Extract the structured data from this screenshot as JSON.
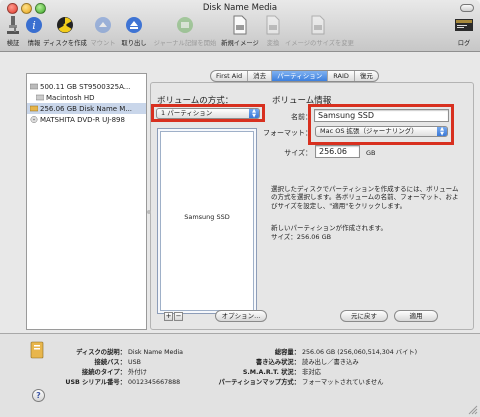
{
  "window": {
    "title": "Disk Name Media"
  },
  "toolbar": [
    {
      "label": "検証",
      "icon": "microscope-icon",
      "enabled": true
    },
    {
      "label": "情報",
      "icon": "info-icon",
      "enabled": true
    },
    {
      "label": "ディスクを作成",
      "icon": "burn-icon",
      "enabled": true
    },
    {
      "label": "マウント",
      "icon": "mount-icon",
      "enabled": false
    },
    {
      "label": "取り出し",
      "icon": "eject-icon",
      "enabled": true
    },
    {
      "label": "ジャーナル記録を開始",
      "icon": "journal-icon",
      "enabled": false
    },
    {
      "label": "新規イメージ",
      "icon": "new-image-icon",
      "enabled": true
    },
    {
      "label": "変換",
      "icon": "convert-icon",
      "enabled": false
    },
    {
      "label": "イメージのサイズを変更",
      "icon": "resize-image-icon",
      "enabled": false
    },
    {
      "label": "ログ",
      "icon": "log-icon",
      "enabled": true
    }
  ],
  "devices": [
    {
      "label": "500.11 GB ST9500325A...",
      "icon": "hard-disk-icon",
      "indent": false,
      "selected": false
    },
    {
      "label": "Macintosh HD",
      "icon": "volume-icon",
      "indent": true,
      "selected": false
    },
    {
      "label": "256.06 GB Disk Name M...",
      "icon": "external-disk-icon",
      "indent": false,
      "selected": true
    },
    {
      "label": "MATSHITA DVD-R UJ-898",
      "icon": "optical-drive-icon",
      "indent": false,
      "selected": false
    }
  ],
  "tabs": [
    {
      "label": "First Aid",
      "active": false
    },
    {
      "label": "消去",
      "active": false
    },
    {
      "label": "パーティション",
      "active": true
    },
    {
      "label": "RAID",
      "active": false
    },
    {
      "label": "復元",
      "active": false
    }
  ],
  "partition": {
    "scheme_heading": "ボリュームの方式：",
    "scheme_value": "1 パーティション",
    "info_heading": "ボリューム情報",
    "name_label": "名前：",
    "name_value": "Samsung SSD",
    "format_label": "フォーマット：",
    "format_value": "Mac OS 拡張（ジャーナリング）",
    "size_label": "サイズ：",
    "size_value": "256.06",
    "size_unit": "GB",
    "map_label": "Samsung SSD",
    "description_1": "選択したディスクでパーティションを作成するには、ボリュームの方式を選択します。各ボリュームの名前、フォーマット、およびサイズを設定し、\"適用\"をクリックします。",
    "description_2": "新しいパーティションが作成されます。",
    "description_3": "サイズ：256.06 GB",
    "add_label": "+",
    "remove_label": "−",
    "options_label": "オプション...",
    "revert_label": "元に戻す",
    "apply_label": "適用"
  },
  "info": {
    "left": [
      {
        "key": "ディスクの説明：",
        "value": "Disk Name Media"
      },
      {
        "key": "接続バス：",
        "value": "USB"
      },
      {
        "key": "接続のタイプ：",
        "value": "外付け"
      },
      {
        "key": "USB シリアル番号：",
        "value": "0012345667888"
      }
    ],
    "right": [
      {
        "key": "総容量：",
        "value": "256.06 GB (256,060,514,304 バイト)"
      },
      {
        "key": "書き込み状況：",
        "value": "読み出し／書き込み"
      },
      {
        "key": "S.M.A.R.T. 状況：",
        "value": "非対応"
      },
      {
        "key": "パーティションマップ方式：",
        "value": "フォーマットされていません"
      }
    ],
    "help_label": "?"
  },
  "colors": {
    "highlight": "#d8301f",
    "accent": "#3d80de",
    "selection": "#c9d6ea"
  }
}
